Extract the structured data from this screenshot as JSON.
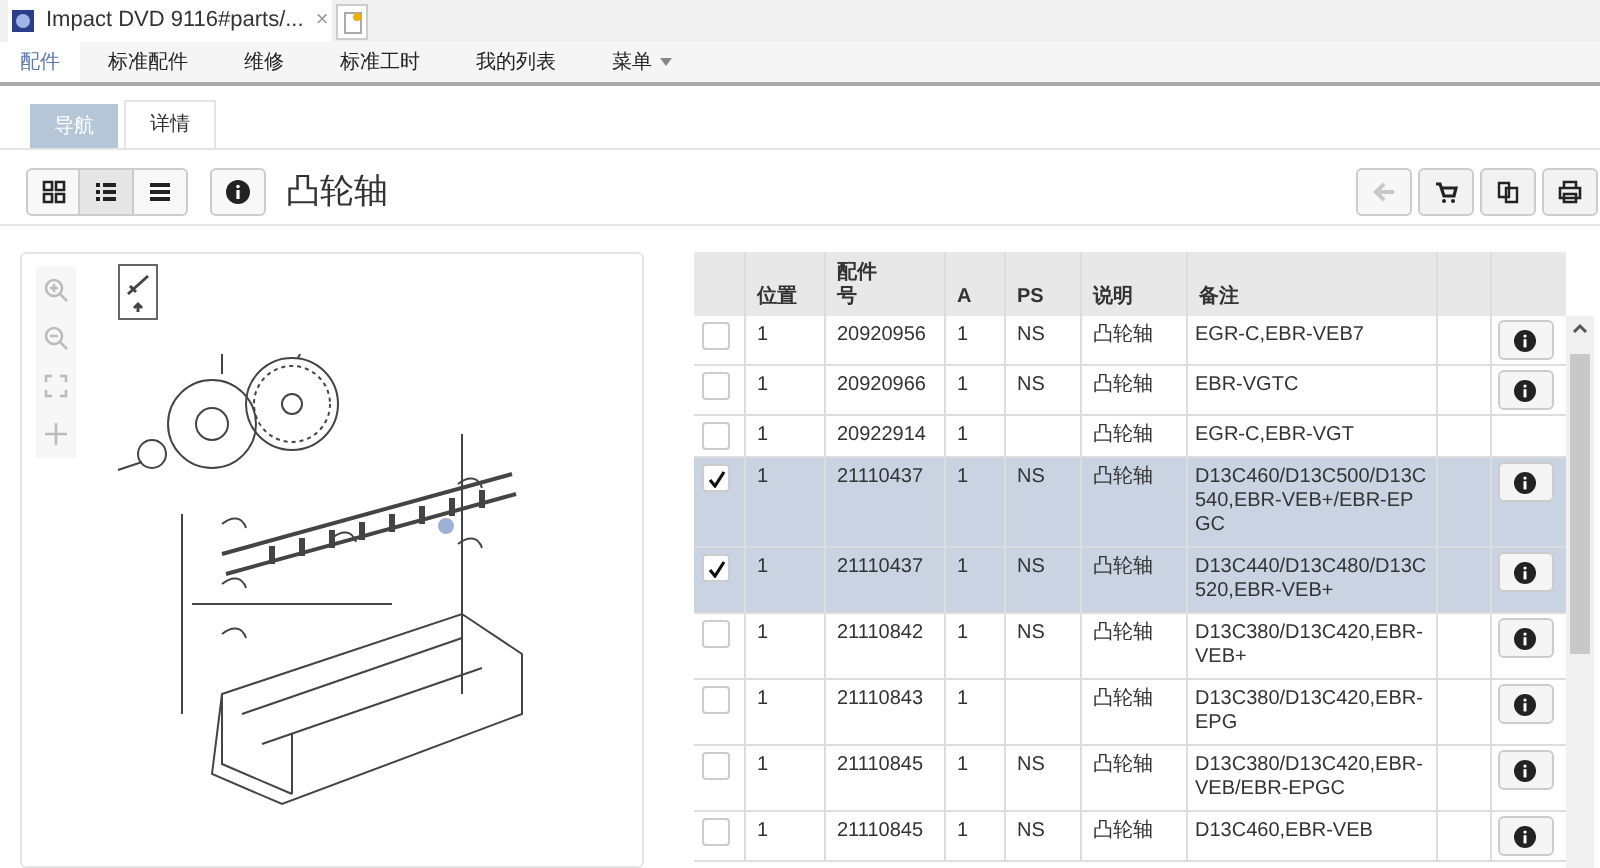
{
  "browser_tab": {
    "title": "Impact DVD 9116#parts/...",
    "close": "×"
  },
  "menu": [
    {
      "label": "配件",
      "selected": true
    },
    {
      "label": "标准配件",
      "selected": false
    },
    {
      "label": "维修",
      "selected": false
    },
    {
      "label": "标准工时",
      "selected": false
    },
    {
      "label": "我的列表",
      "selected": false
    },
    {
      "label": "菜单",
      "selected": false,
      "dropdown": true
    }
  ],
  "subtabs": [
    {
      "label": "导航",
      "selected": false
    },
    {
      "label": "详情",
      "selected": true
    }
  ],
  "view_buttons": [
    {
      "kind": "grid",
      "selected": false
    },
    {
      "kind": "list",
      "selected": true
    },
    {
      "kind": "rows",
      "selected": false
    }
  ],
  "heading": "凸轮轴",
  "actions": [
    {
      "kind": "back",
      "disabled": true
    },
    {
      "kind": "cart",
      "disabled": false
    },
    {
      "kind": "copy",
      "disabled": false
    },
    {
      "kind": "print",
      "disabled": false
    }
  ],
  "table": {
    "columns": [
      "位置",
      "配件号",
      "A",
      "PS",
      "说明",
      "备注"
    ],
    "rows": [
      {
        "checked": false,
        "cells": [
          "1",
          "20920956",
          "1",
          "NS",
          "凸轮轴",
          "EGR-C,EBR-VEB7"
        ],
        "info": true
      },
      {
        "checked": false,
        "cells": [
          "1",
          "20920966",
          "1",
          "NS",
          "凸轮轴",
          "EBR-VGTC"
        ],
        "info": true
      },
      {
        "checked": false,
        "cells": [
          "1",
          "20922914",
          "1",
          "",
          "凸轮轴",
          "EGR-C,EBR-VGT"
        ],
        "info": false
      },
      {
        "checked": true,
        "cells": [
          "1",
          "21110437",
          "1",
          "NS",
          "凸轮轴",
          "D13C460/D13C500/D13C540,EBR-VEB+/EBR-EPGC"
        ],
        "info": true
      },
      {
        "checked": true,
        "cells": [
          "1",
          "21110437",
          "1",
          "NS",
          "凸轮轴",
          "D13C440/D13C480/D13C520,EBR-VEB+"
        ],
        "info": true
      },
      {
        "checked": false,
        "cells": [
          "1",
          "21110842",
          "1",
          "NS",
          "凸轮轴",
          "D13C380/D13C420,EBR-VEB+"
        ],
        "info": true
      },
      {
        "checked": false,
        "cells": [
          "1",
          "21110843",
          "1",
          "",
          "凸轮轴",
          "D13C380/D13C420,EBR-EPG"
        ],
        "info": true
      },
      {
        "checked": false,
        "cells": [
          "1",
          "21110845",
          "1",
          "NS",
          "凸轮轴",
          "D13C380/D13C420,EBR-VEB/EBR-EPGC"
        ],
        "info": true
      },
      {
        "checked": false,
        "cells": [
          "1",
          "21110845",
          "1",
          "NS",
          "凸轮轴",
          "D13C460,EBR-VEB"
        ],
        "info": true
      }
    ]
  }
}
